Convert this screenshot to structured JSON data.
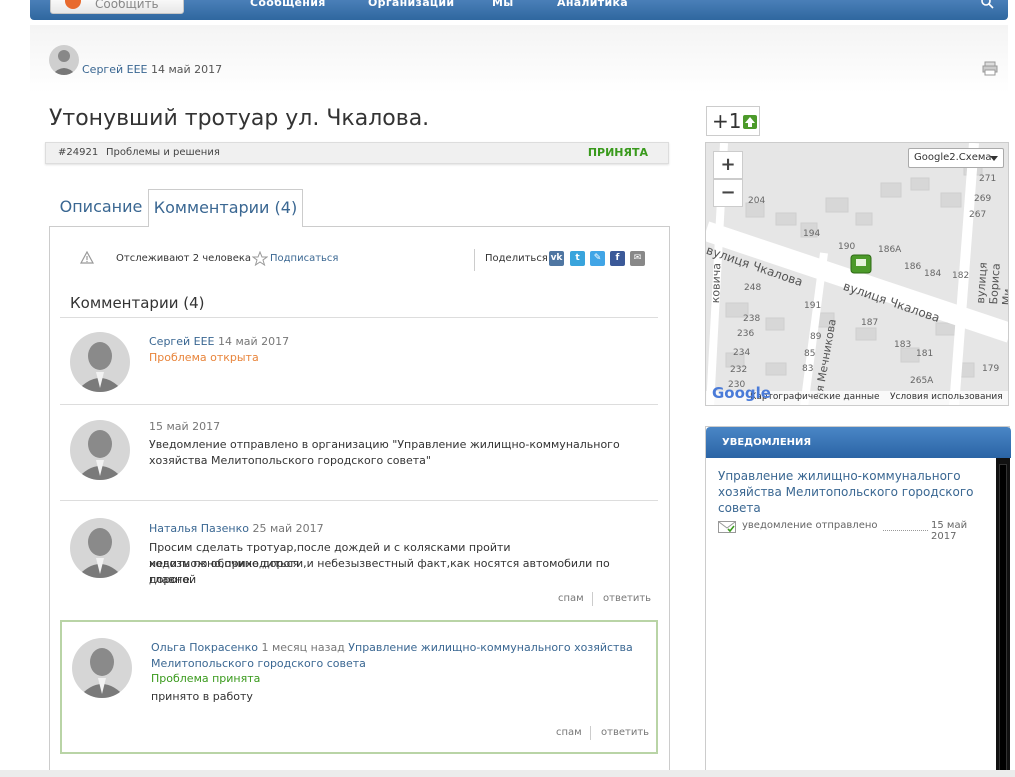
{
  "nav": {
    "message_button": "Сообщить",
    "items": [
      "Сообщения",
      "Организации",
      "Мы",
      "Аналитика"
    ]
  },
  "post": {
    "author": "Сергей ЕЕЕ",
    "date": "14 май 2017",
    "title": "Утонувший тротуар ул. Чкалова.",
    "id": "#24921",
    "category": "Проблемы и решения",
    "status": "ПРИНЯТА"
  },
  "tabs": {
    "description": "Описание",
    "comments": "Комментарии (4)"
  },
  "watch": {
    "text": "Отслеживают 2 человека",
    "subscribe": "Подписаться",
    "share_label": "Поделиться:"
  },
  "comments_heading": "Комментарии (4)",
  "comments": [
    {
      "author": "Сергей ЕЕЕ",
      "date": "14 май 2017",
      "status": "Проблема открыта"
    },
    {
      "date": "15 май 2017",
      "body_1": "Уведомление отправлено в организацию \"Управление жилищно-коммунального",
      "body_2": "хозяйства Мелитопольского городского совета\""
    },
    {
      "author": "Наталья Пазенко",
      "date": "25 май 2017",
      "body_1": "Просим сделать тротуар,после дождей и с колясками пройти невозможно,приходиться",
      "body_2": "ходить по обочине дороги,и небезызвестный факт,как носятся автомобили по главной",
      "body_3": "дороге."
    },
    {
      "author": "Ольга Покрасенко",
      "date": "1 месяц назад",
      "org_1": "Управление жилищно-коммунального хозяйства",
      "org_2": "Мелитопольского городского совета",
      "status": "Проблема принята",
      "body": "принято в работу"
    }
  ],
  "actions": {
    "spam": "спам",
    "reply": "ответить"
  },
  "vote": {
    "label": "+1"
  },
  "map": {
    "zoom_in": "+",
    "zoom_out": "−",
    "type": "Google2.Схема",
    "streets": [
      "вулиця Чкалова",
      "вулиця Чкалова",
      "ця Мечникова",
      "вулиця Бориса Ми",
      "ковича"
    ],
    "houses": [
      "271",
      "269",
      "267",
      "204",
      "194",
      "190",
      "186А",
      "186",
      "184",
      "182",
      "248",
      "238",
      "191",
      "187",
      "236",
      "234",
      "232",
      "230",
      "89",
      "85",
      "83",
      "183",
      "181",
      "179",
      "265А"
    ],
    "logo": "Google",
    "footer_data": "Картографические данные",
    "footer_terms": "Условия использования"
  },
  "notifications": {
    "heading": "УВЕДОМЛЕНИЯ",
    "org": "Управление жилищно-коммунального хозяйства Мелитопольского городского совета",
    "line_text": "уведомление отправлено",
    "line_date": "15 май 2017"
  },
  "colors": {
    "accent": "#3a6792",
    "status_green": "#3a9a1d",
    "status_orange": "#e8843a",
    "nav_blue": "#2f679f"
  }
}
